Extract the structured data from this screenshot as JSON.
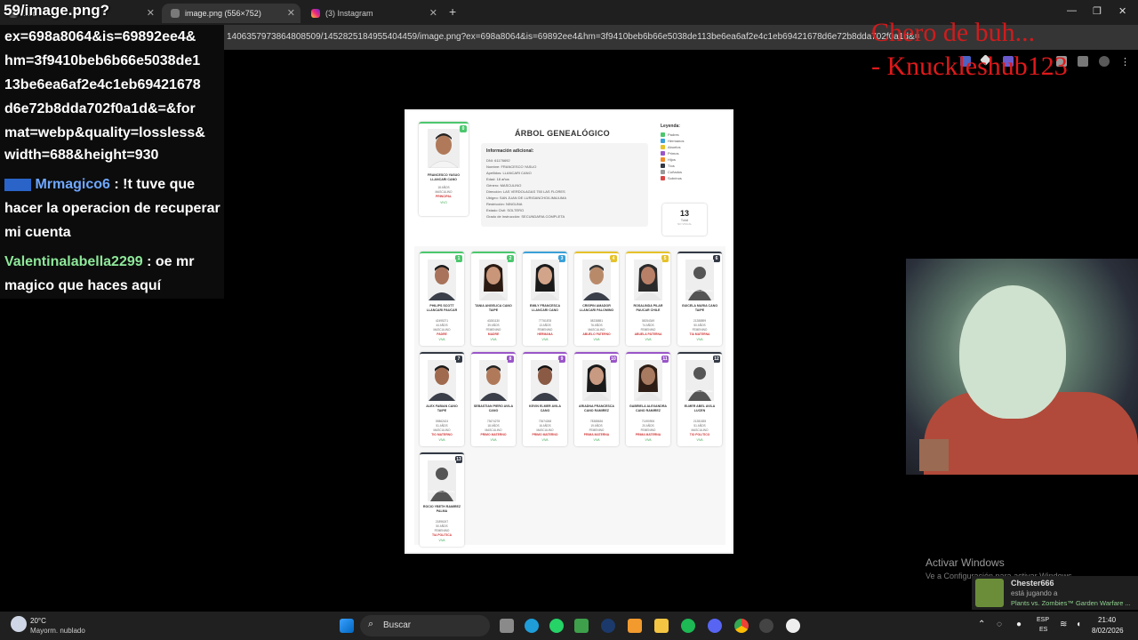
{
  "browser": {
    "tabs": [
      {
        "label": "...rd",
        "active": false,
        "color": "#5a5a5a"
      },
      {
        "label": "image.png (556×752)",
        "active": true,
        "color": "#7a7a7a"
      },
      {
        "label": "(3) Instagram",
        "active": false,
        "color": "#d62976"
      }
    ],
    "url": "1406357973864808509/1452825184955404459/image.png?ex=698a8064&is=69892ee4&hm=3f9410beb6b66e5038de113be6ea6af2e4c1eb69421678d6e72b8dda702f0a1d&=&format=web"
  },
  "overlay": {
    "title": "59/image.png?",
    "chat_url_lines": [
      "ex=698a8064&is=69892ee4&",
      "hm=3f9410beb6b66e5038de1",
      "13be6ea6af2e4c1eb69421678",
      "d6e72b8dda702f0a1d&=&for",
      "mat=webp&quality=lossless&",
      "width=688&height=930"
    ],
    "chat": [
      {
        "user": "Mrmagico6",
        "text": " : !t tuve que hacer la operacion de recuperar mi cuenta"
      },
      {
        "user": "Valentinalabella2299",
        "text": " : oe mr magico que haces aquí"
      }
    ],
    "red_line1": "Chero de buh...",
    "red_line2": "- Knuckleshub123"
  },
  "document": {
    "title": "ÁRBOL GENEALÓGICO",
    "main_person": {
      "name": "FRANCESCO YASUO LLANCARI CANO",
      "age": "18 AÑOS",
      "gender": "MASCULINO",
      "role": "PRINCIPAL",
      "status": "VIVO",
      "badge": "0"
    },
    "info_header": "Información adicional:",
    "info_lines": [
      "DNI: 61176692",
      "Nombre: FRANCESCO YASUO",
      "Apellidos: LLANCARI CANO",
      "Edad: 18 años",
      "Género: MASCULINO",
      "Dirección: LAS VERDOLAGAS 750 LAS FLORES",
      "Ubigeo: SAN JUAN DE LURIGANCHO/LIMA/LIMA",
      "Restricción: NINGUNA",
      "Estado Civil: SOLTERO",
      "Grado de Instrucción: SECUNDARIA COMPLETA"
    ],
    "legend_title": "Leyenda:",
    "legend": [
      {
        "label": "Padres",
        "color": "#4bc76d"
      },
      {
        "label": "Hermanos",
        "color": "#3aa0d8"
      },
      {
        "label": "Abuelos",
        "color": "#e6c229"
      },
      {
        "label": "Primos",
        "color": "#9a55c8"
      },
      {
        "label": "Hijos",
        "color": "#f08a2a"
      },
      {
        "label": "Tíos",
        "color": "#333a45"
      },
      {
        "label": "Cuñados",
        "color": "#9a9a9a"
      },
      {
        "label": "Sobrinos",
        "color": "#d94545"
      }
    ],
    "total": {
      "value": "13",
      "label": "Total",
      "sub": "NO VISUAL"
    },
    "relatives": [
      {
        "badge": "1",
        "name": "PHILIPS SCOTT LLANCARI PAUCAR",
        "dni": "42495271",
        "age": "44 AÑOS",
        "gender": "MASCULINO",
        "role": "PADRE",
        "status": "VIVA",
        "color": "#4bc76d",
        "photo": "m1"
      },
      {
        "badge": "2",
        "name": "TANIA ANGELICA CANO TAIPE",
        "dni": "40281130",
        "age": "39 AÑOS",
        "gender": "FEMENINO",
        "role": "MADRE",
        "status": "VIVA",
        "color": "#4bc76d",
        "photo": "f1"
      },
      {
        "badge": "3",
        "name": "EMILY FRANCESCA LLANCARI CANO",
        "dni": "77761878",
        "age": "13 AÑOS",
        "gender": "FEMENINO",
        "role": "HERMANA",
        "status": "VIVA",
        "color": "#3aa0d8",
        "photo": "f2"
      },
      {
        "badge": "4",
        "name": "CRISPIN AMADOR LLANCARI PALOMINO",
        "dni": "08238851",
        "age": "76 AÑOS",
        "gender": "MASCULINO",
        "role": "ABUELO PATERNO",
        "status": "VIVA",
        "color": "#e6c229",
        "photo": "m2"
      },
      {
        "badge": "5",
        "name": "ROSALINDA PILAR PAUCAR CHILE",
        "dni": "08254349",
        "age": "74 AÑOS",
        "gender": "FEMENINO",
        "role": "ABUELA PATERNA",
        "status": "VIVA",
        "color": "#e6c229",
        "photo": "f3"
      },
      {
        "badge": "6",
        "name": "GUICELA MARIA CANO TAIPE",
        "dni": "21288899",
        "age": "50 AÑOS",
        "gender": "FEMENINO",
        "role": "TIA MATERNA",
        "status": "VIVA",
        "color": "#333a45",
        "photo": "none"
      },
      {
        "badge": "7",
        "name": "ALEX FABIAN CANO TAIPE",
        "dni": "09862424",
        "age": "51 AÑOS",
        "gender": "MASCULINO",
        "role": "TIO MATERNO",
        "status": "VIVA",
        "color": "#333a45",
        "photo": "m3"
      },
      {
        "badge": "8",
        "name": "SEBASTIAN PIERO AVILA CANO",
        "dni": "73674278",
        "age": "18 AÑOS",
        "gender": "MASCULINO",
        "role": "PRIMO MATERNO",
        "status": "VIVA",
        "color": "#9a55c8",
        "photo": "m4"
      },
      {
        "badge": "9",
        "name": "KEVIN ELMER AVILA CANO",
        "dni": "73674268",
        "age": "16 AÑOS",
        "gender": "MASCULINO",
        "role": "PRIMO MATERNO",
        "status": "VIVA",
        "color": "#9a55c8",
        "photo": "m5"
      },
      {
        "badge": "10",
        "name": "ARIADNA FRANCESCA CANO RAMIREZ",
        "dni": "78388636",
        "age": "19 AÑOS",
        "gender": "FEMENINO",
        "role": "PRIMA MATERNA",
        "status": "VIVA",
        "color": "#9a55c8",
        "photo": "f4"
      },
      {
        "badge": "11",
        "name": "GABRIELA ALEXANDRA CANO RAMIREZ",
        "dni": "71490906",
        "age": "20 AÑOS",
        "gender": "FEMENINO",
        "role": "PRIMA MATERNA",
        "status": "VIVA",
        "color": "#9a55c8",
        "photo": "f5"
      },
      {
        "badge": "12",
        "name": "ELMER ABEL AVILA LUCEN",
        "dni": "21281835",
        "age": "51 AÑOS",
        "gender": "MASCULINO",
        "role": "TIO POLITICO",
        "status": "VIVA",
        "color": "#333a45",
        "photo": "none"
      },
      {
        "badge": "13",
        "name": "ROCIO YBETH RAMIREZ PALMA",
        "dni": "21896247",
        "age": "50 AÑOS",
        "gender": "FEMENINO",
        "role": "TIA POLITICA",
        "status": "VIVA",
        "color": "#333a45",
        "photo": "none"
      }
    ],
    "no_photo_text": "No hay foto disponible"
  },
  "windows": {
    "activate_title": "Activar Windows",
    "activate_sub": "Ve a Configuración para activar Windows.",
    "notif_user": "Chester666",
    "notif_line": "está jugando a",
    "notif_game": "Plants vs. Zombies™ Garden Warfare ..."
  },
  "taskbar": {
    "weather_temp": "20°C",
    "weather_desc": "Mayorm. nublado",
    "search_label": "Buscar",
    "lang_top": "ESP",
    "lang_bottom": "ES",
    "time": "21:40",
    "date": "8/02/2026"
  }
}
